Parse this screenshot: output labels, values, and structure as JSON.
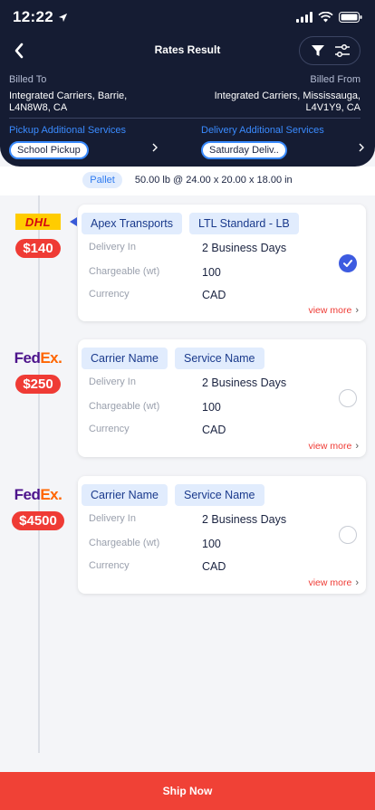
{
  "status_bar": {
    "time": "12:22"
  },
  "header": {
    "title": "Rates Result",
    "billed_to": {
      "caption": "Billed To",
      "line1": "Integrated Carriers, Barrie,",
      "line2": "L4N8W8, CA"
    },
    "billed_from": {
      "caption": "Billed From",
      "line1": "Integrated Carriers, Mississauga,",
      "line2": "L4V1Y9, CA"
    },
    "pickup_services": {
      "caption": "Pickup Additional Services",
      "chip": "School Pickup"
    },
    "delivery_services": {
      "caption": "Delivery Additional Services",
      "chip": "Saturday Deliv.."
    }
  },
  "pallet": {
    "chip": "Pallet",
    "details": "50.00 lb @ 24.00 x 20.00 x 18.00 in"
  },
  "rates": [
    {
      "carrier_logo": "DHL",
      "price": "$140",
      "tag1": "Apex Transports",
      "tag2": "LTL Standard - LB",
      "delivery_label": "Delivery In",
      "delivery_value": "2 Business Days",
      "weight_label": "Chargeable (wt)",
      "weight_value": "100",
      "currency_label": "Currency",
      "currency_value": "CAD",
      "selected": true,
      "view_more": "view more"
    },
    {
      "carrier_logo": "FedEx",
      "price": "$250",
      "tag1": "Carrier Name",
      "tag2": "Service Name",
      "delivery_label": "Delivery In",
      "delivery_value": "2 Business Days",
      "weight_label": "Chargeable (wt)",
      "weight_value": "100",
      "currency_label": "Currency",
      "currency_value": "CAD",
      "selected": false,
      "view_more": "view more"
    },
    {
      "carrier_logo": "FedEx",
      "price": "$4500",
      "tag1": "Carrier Name",
      "tag2": "Service Name",
      "delivery_label": "Delivery In",
      "delivery_value": "2 Business Days",
      "weight_label": "Chargeable (wt)",
      "weight_value": "100",
      "currency_label": "Currency",
      "currency_value": "CAD",
      "selected": false,
      "view_more": "view more"
    }
  ],
  "logos": {
    "dhl": "DHL",
    "fedex_fed": "Fed",
    "fedex_ex": "Ex",
    "fedex_dot": "."
  },
  "ship_button": {
    "label": "Ship Now"
  },
  "colors": {
    "header_bg": "#151c33",
    "accent_blue": "#3a8bff",
    "price_red": "#ef3b35",
    "select_blue": "#3d5be0"
  }
}
